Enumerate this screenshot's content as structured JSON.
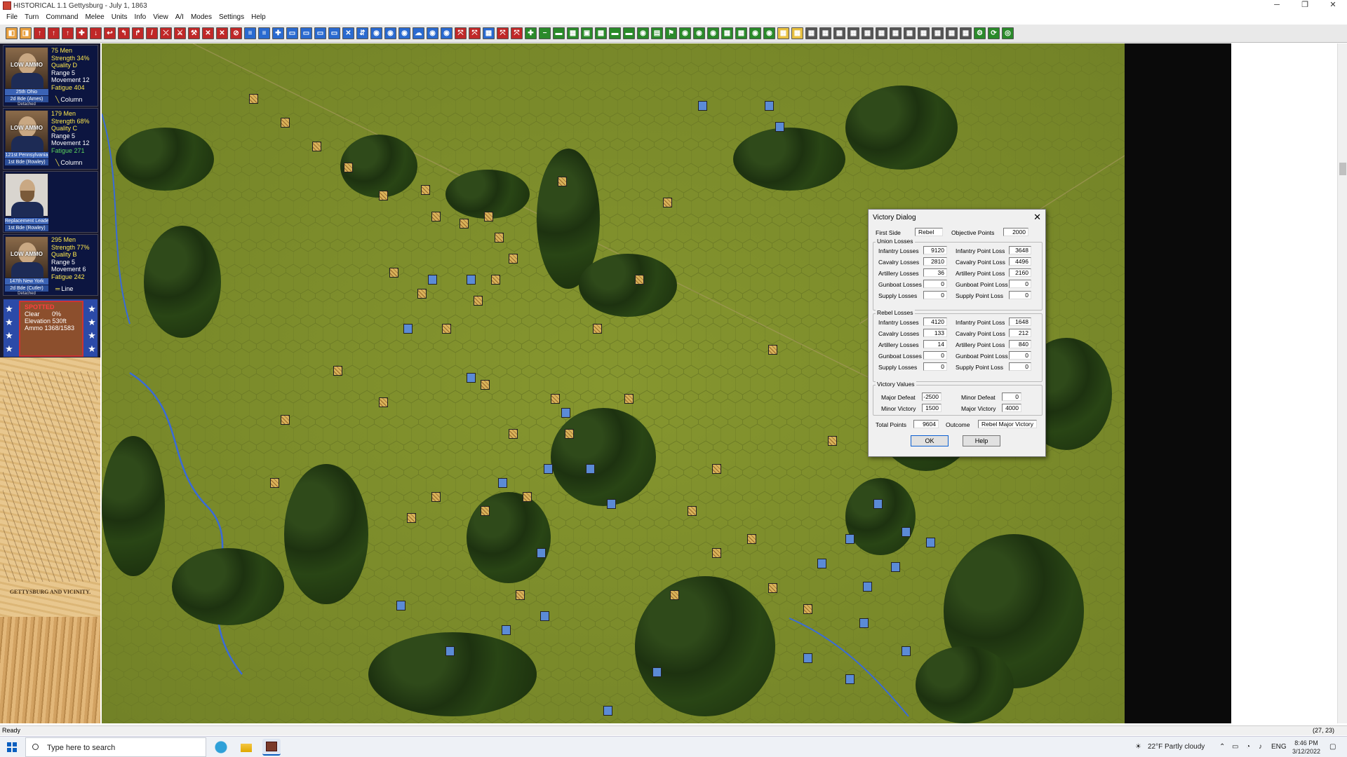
{
  "window": {
    "title": "HISTORICAL 1.1 Gettysburg - July 1, 1863",
    "minimize": "─",
    "maximize": "❐",
    "close": "✕"
  },
  "menu": [
    "File",
    "Turn",
    "Command",
    "Melee",
    "Units",
    "Info",
    "View",
    "A/I",
    "Modes",
    "Settings",
    "Help"
  ],
  "toolbar_colors": [
    "#e8a040",
    "#e8a040",
    "#c02828",
    "#c02828",
    "#c02828",
    "#c02828",
    "#c02828",
    "#c02828",
    "#c02828",
    "#c02828",
    "#c02828",
    "#c02828",
    "#c02828",
    "#c02828",
    "#c02828",
    "#c02828",
    "#c02828",
    "#2a6ad0",
    "#2a6ad0",
    "#2a6ad0",
    "#2a6ad0",
    "#2a6ad0",
    "#2a6ad0",
    "#2a6ad0",
    "#2a6ad0",
    "#2a6ad0",
    "#2a6ad0",
    "#2a6ad0",
    "#2a6ad0",
    "#2a6ad0",
    "#2a6ad0",
    "#2a6ad0",
    "#c02828",
    "#c02828",
    "#2a6ad0",
    "#c02828",
    "#c02828",
    "#2a8a2a",
    "#2a8a2a",
    "#2a8a2a",
    "#2a8a2a",
    "#2a8a2a",
    "#2a8a2a",
    "#2a8a2a",
    "#2a8a2a",
    "#2a8a2a",
    "#2a8a2a",
    "#2a8a2a",
    "#2a8a2a",
    "#2a8a2a",
    "#2a8a2a",
    "#2a8a2a",
    "#2a8a2a",
    "#2a8a2a",
    "#2a8a2a",
    "#e8c040",
    "#e8c040",
    "#555555",
    "#555555",
    "#555555",
    "#555555",
    "#555555",
    "#555555",
    "#555555",
    "#555555",
    "#555555",
    "#555555",
    "#555555",
    "#555555",
    "#2a8a2a",
    "#2a8a2a",
    "#2a8a2a"
  ],
  "units": [
    {
      "ammo": "LOW AMMO",
      "men": "75 Men",
      "strength": "Strength 34%",
      "quality": "Quality D",
      "range": "Range 5",
      "movement": "Movement 12",
      "fatigue": "Fatigue 404",
      "name": "25th Ohio",
      "brigade": "2d Bde (Ames)",
      "status": "Detached",
      "formation": "Column"
    },
    {
      "ammo": "LOW AMMO",
      "men": "179 Men",
      "strength": "Strength 68%",
      "quality": "Quality C",
      "range": "Range 5",
      "movement": "Movement 12",
      "fatigue": "Fatigue 271",
      "name": "121st Pennsylvania",
      "brigade": "1st Bde (Rowley)",
      "status": "",
      "formation": "Column"
    },
    {
      "ammo": "LOW AMMO",
      "men": "295 Men",
      "strength": "Strength 77%",
      "quality": "Quality B",
      "range": "Range 5",
      "movement": "Movement 6",
      "fatigue": "Fatigue 242",
      "name": "147th New York",
      "brigade": "2d Bde (Cutler)",
      "status": "Detached",
      "formation": "Line"
    }
  ],
  "leader": {
    "name": "Replacement Leader",
    "brigade": "1st Bde (Rowley)"
  },
  "terrain": {
    "spotted": "SPOTTED",
    "type": "Clear",
    "type_value": "0%",
    "elevation": "Elevation",
    "elevation_value": "530ft",
    "ammo": "Ammo 1368/1583"
  },
  "old_map_caption": "GETTYSBURG AND VICINITY.",
  "victory_dialog": {
    "title": "Victory Dialog",
    "first_side_label": "First Side",
    "first_side": "Rebel",
    "objective_points_label": "Objective Points",
    "objective_points": "2000",
    "union_group": "Union Losses",
    "union": {
      "infantry_losses": "9120",
      "infantry_point_loss": "3648",
      "cavalry_losses": "2810",
      "cavalry_point_loss": "4496",
      "artillery_losses": "36",
      "artillery_point_loss": "2160",
      "gunboat_losses": "0",
      "gunboat_point_loss": "0",
      "supply_losses": "0",
      "supply_point_loss": "0"
    },
    "rebel_group": "Rebel Losses",
    "rebel": {
      "infantry_losses": "4120",
      "infantry_point_loss": "1648",
      "cavalry_losses": "133",
      "cavalry_point_loss": "212",
      "artillery_losses": "14",
      "artillery_point_loss": "840",
      "gunboat_losses": "0",
      "gunboat_point_loss": "0",
      "supply_losses": "0",
      "supply_point_loss": "0"
    },
    "labels": {
      "infantry_losses": "Infantry Losses",
      "infantry_point_loss": "Infantry Point Loss",
      "cavalry_losses": "Cavalry Losses",
      "cavalry_point_loss": "Cavalry Point Loss",
      "artillery_losses": "Artillery Losses",
      "artillery_point_loss": "Artillery Point Loss",
      "gunboat_losses": "Gunboat Losses",
      "gunboat_point_loss": "Gunboat Point Loss",
      "supply_losses": "Supply Losses",
      "supply_point_loss": "Supply Point Loss"
    },
    "victory_group": "Victory Values",
    "major_defeat_label": "Major Defeat",
    "major_defeat": "-2500",
    "minor_defeat_label": "Minor Defeat",
    "minor_defeat": "0",
    "minor_victory_label": "Minor Victory",
    "minor_victory": "1500",
    "major_victory_label": "Major Victory",
    "major_victory": "4000",
    "total_points_label": "Total Points",
    "total_points": "9604",
    "outcome_label": "Outcome",
    "outcome": "Rebel Major Victory",
    "ok": "OK",
    "help": "Help"
  },
  "status": {
    "left": "Ready",
    "right": "(27, 23)"
  },
  "taskbar": {
    "search_placeholder": "Type here to search",
    "weather": "22°F  Partly cloudy",
    "language": "ENG",
    "time": "8:46 PM",
    "date": "3/12/2022"
  }
}
